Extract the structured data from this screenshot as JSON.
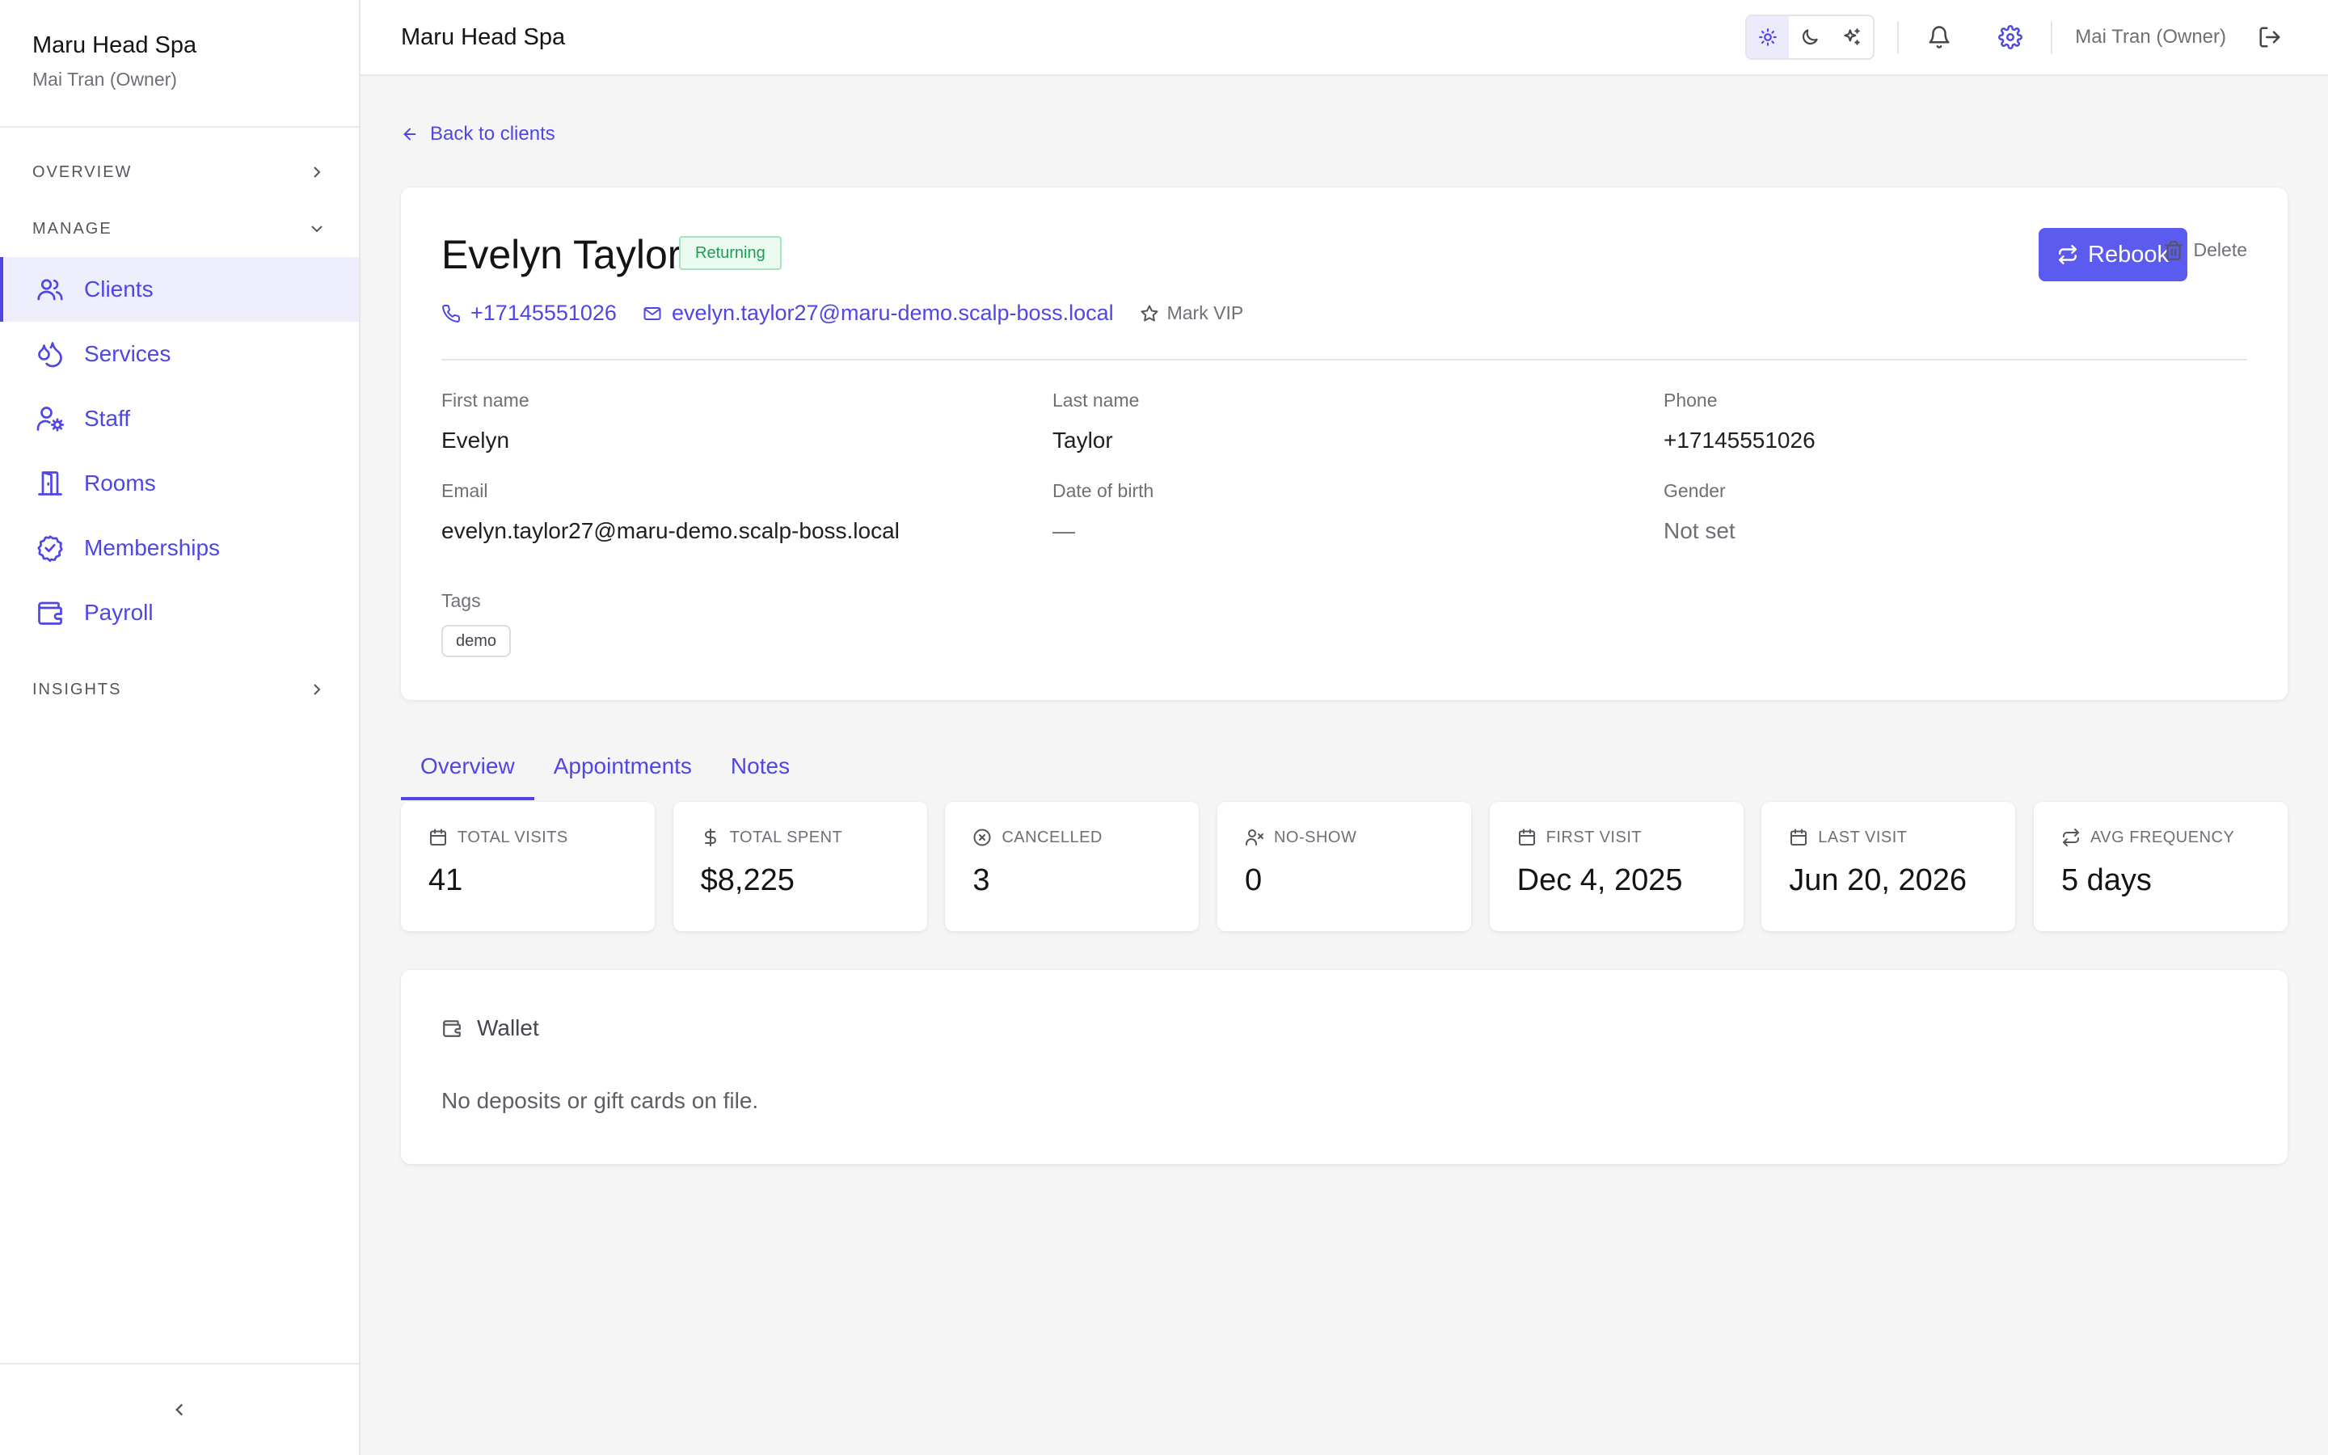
{
  "org": {
    "name": "Maru Head Spa",
    "user": "Mai Tran (Owner)"
  },
  "sidebar": {
    "overview_label": "OVERVIEW",
    "manage_label": "MANAGE",
    "insights_label": "INSIGHTS",
    "items": [
      {
        "label": "Clients",
        "icon": "users-icon",
        "active": true
      },
      {
        "label": "Services",
        "icon": "droplets-icon"
      },
      {
        "label": "Staff",
        "icon": "user-cog-icon"
      },
      {
        "label": "Rooms",
        "icon": "door-icon"
      },
      {
        "label": "Memberships",
        "icon": "badge-check-icon"
      },
      {
        "label": "Payroll",
        "icon": "wallet-icon"
      }
    ]
  },
  "topbar": {
    "title": "Maru Head Spa",
    "user_label": "Mai Tran (Owner)",
    "theme_options": [
      "light",
      "dark",
      "sparkle"
    ],
    "theme_selected": "light"
  },
  "back_label": "Back to clients",
  "client": {
    "name": "Evelyn Taylor",
    "status_badge": "Returning",
    "phone": "+17145551026",
    "email": "evelyn.taylor27@maru-demo.scalp-boss.local",
    "mark_vip_label": "Mark VIP",
    "rebook_label": "Rebook",
    "delete_label": "Delete"
  },
  "fields": {
    "first_name": {
      "label": "First name",
      "value": "Evelyn"
    },
    "last_name": {
      "label": "Last name",
      "value": "Taylor"
    },
    "phone": {
      "label": "Phone",
      "value": "+17145551026"
    },
    "email": {
      "label": "Email",
      "value": "evelyn.taylor27@maru-demo.scalp-boss.local"
    },
    "dob": {
      "label": "Date of birth",
      "value": "—"
    },
    "gender": {
      "label": "Gender",
      "value": "Not set"
    },
    "tags": {
      "label": "Tags",
      "items": [
        "demo"
      ]
    }
  },
  "tabs": [
    {
      "label": "Overview",
      "active": true
    },
    {
      "label": "Appointments"
    },
    {
      "label": "Notes"
    }
  ],
  "stats": [
    {
      "label": "TOTAL VISITS",
      "value": "41",
      "icon": "calendar-icon"
    },
    {
      "label": "TOTAL SPENT",
      "value": "$8,225",
      "icon": "dollar-icon"
    },
    {
      "label": "CANCELLED",
      "value": "3",
      "icon": "x-circle-icon"
    },
    {
      "label": "NO-SHOW",
      "value": "0",
      "icon": "user-x-icon"
    },
    {
      "label": "FIRST VISIT",
      "value": "Dec 4, 2025",
      "icon": "calendar-icon"
    },
    {
      "label": "LAST VISIT",
      "value": "Jun 20, 2026",
      "icon": "calendar-icon"
    },
    {
      "label": "AVG FREQUENCY",
      "value": "5 days",
      "icon": "repeat-icon"
    }
  ],
  "wallet": {
    "title": "Wallet",
    "empty_text": "No deposits or gift cards on file."
  },
  "colors": {
    "accent": "#4f46e5",
    "button": "#5b5bf0",
    "returning_badge_text": "#1f9d55",
    "returning_badge_bg": "#ecfbf1"
  }
}
